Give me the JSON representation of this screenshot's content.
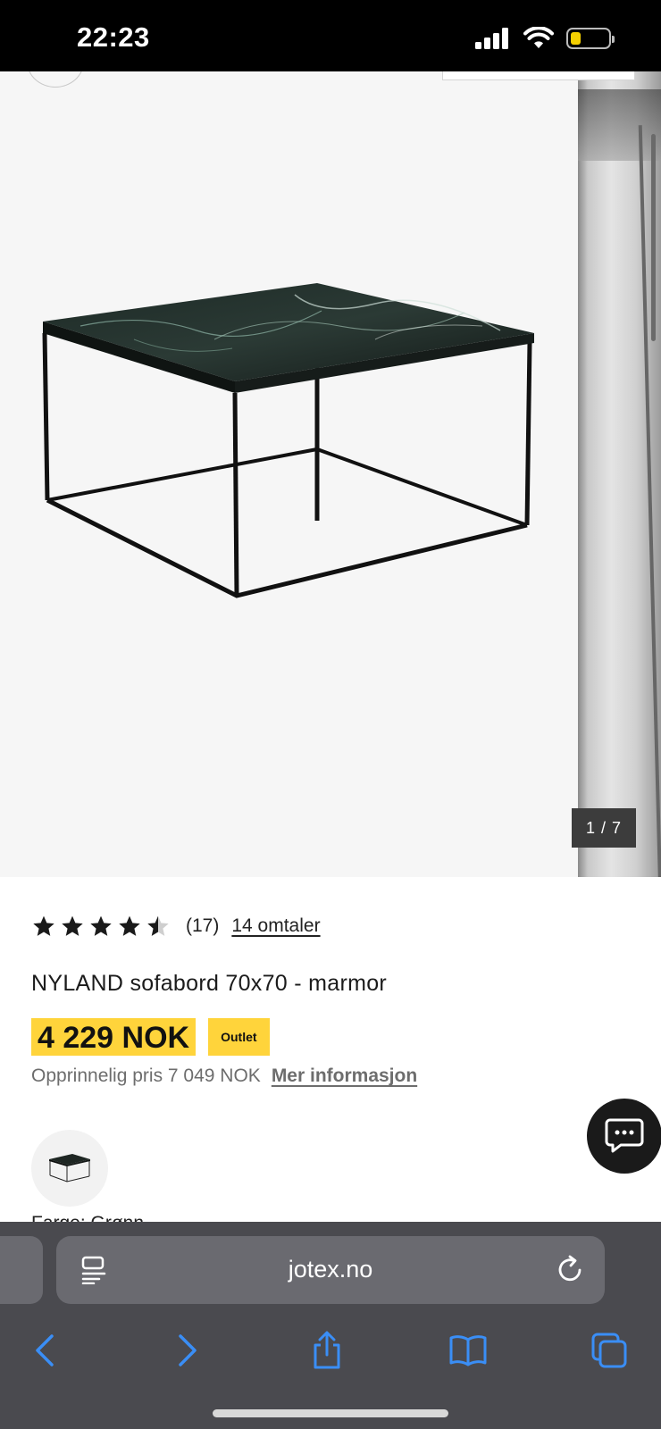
{
  "status_bar": {
    "time": "22:23",
    "battery_level": 0.2
  },
  "gallery": {
    "counter": "1 / 7"
  },
  "product": {
    "rating": 4.5,
    "rating_count": "(17)",
    "reviews_link": "14 omtaler",
    "title": "NYLAND sofabord 70x70 - marmor",
    "price": "4 229 NOK",
    "badge": "Outlet",
    "original_price": "Opprinnelig pris 7 049 NOK",
    "more_info": "Mer informasjon",
    "color_label": "Farge: Grønn"
  },
  "browser": {
    "url": "jotex.no"
  },
  "colors": {
    "accent_yellow": "#ffd43b",
    "ios_blue": "#3a8ef6",
    "chrome_bg": "#4a4a4f"
  }
}
